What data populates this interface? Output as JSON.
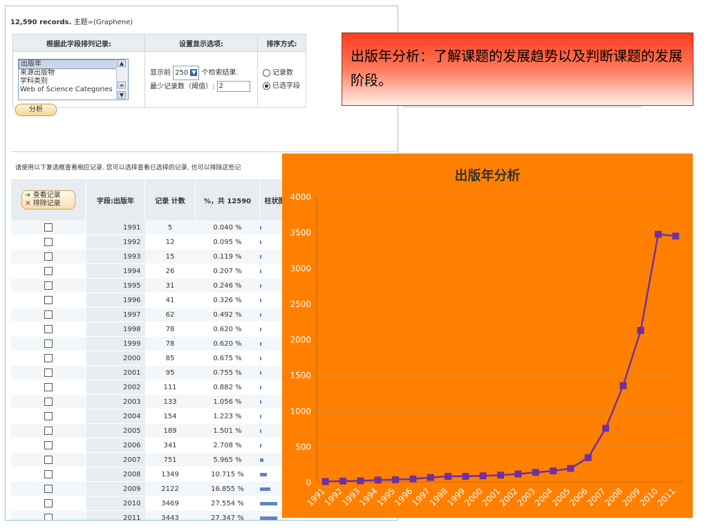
{
  "summary": {
    "count": "12,590 records.",
    "topic": "主题=(Graphene)"
  },
  "options": {
    "headers": [
      "根据此字段排列记录:",
      "设置显示选项:",
      "排序方式:"
    ],
    "fields": [
      "出版年",
      "来源出版物",
      "学科类别",
      "Web of Science Categories"
    ],
    "show_prefix": "显示前",
    "show_value": "250",
    "show_suffix": "个检索结果.",
    "min_label": "最少记录数（阈值）:",
    "min_value": "2",
    "sort_record": "记录数",
    "sort_field": "已选字段"
  },
  "analyze_button": "分析",
  "instruction": "请使用以下复选框查看相应记录. 您可以选择查看已选择的记录, 也可以排除这些记",
  "table": {
    "view_label": "查看记录",
    "exclude_label": "排除记录",
    "col_field": "字段:出版年",
    "col_count": "记录 计数",
    "col_pct": "%，共 12590",
    "col_bar": "柱状图",
    "rows": [
      {
        "year": "1991",
        "count": "5",
        "pct": "0.040 %"
      },
      {
        "year": "1992",
        "count": "12",
        "pct": "0.095 %"
      },
      {
        "year": "1993",
        "count": "15",
        "pct": "0.119 %"
      },
      {
        "year": "1994",
        "count": "26",
        "pct": "0.207 %"
      },
      {
        "year": "1995",
        "count": "31",
        "pct": "0.246 %"
      },
      {
        "year": "1996",
        "count": "41",
        "pct": "0.326 %"
      },
      {
        "year": "1997",
        "count": "62",
        "pct": "0.492 %"
      },
      {
        "year": "1998",
        "count": "78",
        "pct": "0.620 %"
      },
      {
        "year": "1999",
        "count": "78",
        "pct": "0.620 %"
      },
      {
        "year": "2000",
        "count": "85",
        "pct": "0.675 %"
      },
      {
        "year": "2001",
        "count": "95",
        "pct": "0.755 %"
      },
      {
        "year": "2002",
        "count": "111",
        "pct": "0.882 %"
      },
      {
        "year": "2003",
        "count": "133",
        "pct": "1.056 %"
      },
      {
        "year": "2004",
        "count": "154",
        "pct": "1.223 %"
      },
      {
        "year": "2005",
        "count": "189",
        "pct": "1.501 %"
      },
      {
        "year": "2006",
        "count": "341",
        "pct": "2.708 %"
      },
      {
        "year": "2007",
        "count": "751",
        "pct": "5.965 %"
      },
      {
        "year": "2008",
        "count": "1349",
        "pct": "10.715 %"
      },
      {
        "year": "2009",
        "count": "2122",
        "pct": "16.855 %"
      },
      {
        "year": "2010",
        "count": "3469",
        "pct": "27.554 %"
      },
      {
        "year": "2011",
        "count": "3443",
        "pct": "27.347 %"
      }
    ]
  },
  "callout": "出版年分析：了解课题的发展趋势以及判断课题的发展阶段。",
  "colors": {
    "chart_bg": "#ff8000",
    "line": "#7030a0",
    "marker": "#7030a0",
    "callout_top": "#fe3c1f"
  },
  "chart_data": {
    "type": "line",
    "title": "出版年分析",
    "categories": [
      "1991",
      "1992",
      "1993",
      "1994",
      "1995",
      "1996",
      "1997",
      "1998",
      "1999",
      "2000",
      "2001",
      "2002",
      "2003",
      "2004",
      "2005",
      "2006",
      "2007",
      "2008",
      "2009",
      "2010",
      "2011"
    ],
    "values": [
      5,
      12,
      15,
      26,
      31,
      41,
      62,
      78,
      78,
      85,
      95,
      111,
      133,
      154,
      189,
      341,
      751,
      1349,
      2122,
      3469,
      3443
    ],
    "ylim": [
      0,
      4000
    ],
    "yticks": [
      0,
      500,
      1000,
      1500,
      2000,
      2500,
      3000,
      3500,
      4000
    ],
    "xlabel": "",
    "ylabel": "",
    "grid": true,
    "legend": "none"
  }
}
